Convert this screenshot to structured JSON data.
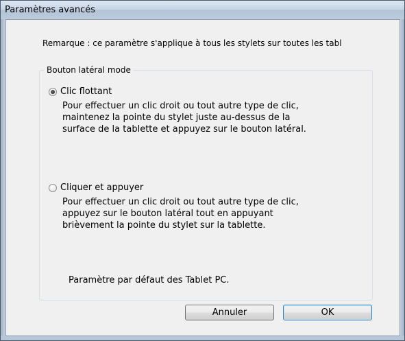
{
  "window": {
    "title": "Paramètres avancés"
  },
  "note": "Remarque : ce paramètre s'applique à tous les stylets sur toutes les tabl",
  "group": {
    "label": "Bouton latéral mode",
    "options": [
      {
        "label": "Clic flottant",
        "checked": true,
        "description": [
          "Pour effectuer un clic droit ou tout autre type de clic,",
          "maintenez la pointe du stylet juste au-dessus de la",
          "surface de la tablette et appuyez sur le bouton latéral."
        ]
      },
      {
        "label": "Cliquer et appuyer",
        "checked": false,
        "description": [
          "Pour effectuer un clic droit ou tout autre type de clic,",
          "appuyez sur le bouton latéral tout en appuyant",
          "brièvement la pointe du stylet sur la tablette."
        ]
      }
    ],
    "default_note": "Paramètre par défaut des Tablet PC."
  },
  "buttons": {
    "cancel": "Annuler",
    "ok": "OK"
  }
}
